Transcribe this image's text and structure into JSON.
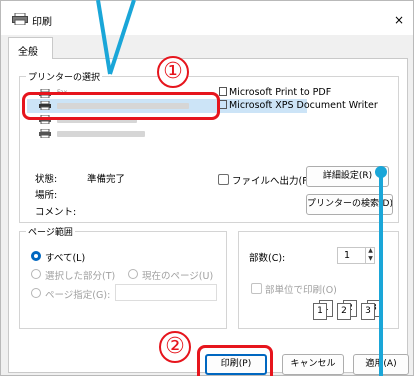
{
  "window": {
    "title": "印刷",
    "close_label": "×"
  },
  "tabs": [
    {
      "label": "全般"
    }
  ],
  "printer_group": {
    "label": "プリンターの選択"
  },
  "printers": [
    {
      "label": "Fax"
    },
    {
      "label": "Microsoft Print to PDF"
    },
    {
      "label": "Microsoft XPS Document Writer"
    }
  ],
  "status": {
    "state_label": "状態:",
    "state_value": "準備完了",
    "location_label": "場所:",
    "comment_label": "コメント:"
  },
  "print_to_file": {
    "label": "ファイルへ出力(F)"
  },
  "buttons": {
    "preferences": "詳細設定(R)",
    "find_printer": "プリンターの検索(D)...",
    "print": "印刷(P)",
    "cancel": "キャンセル",
    "apply": "適用(A)"
  },
  "page_range": {
    "label": "ページ範囲",
    "all": "すべて(L)",
    "selection": "選択した部分(T)",
    "current_page": "現在のページ(U)",
    "pages": "ページ指定(G):",
    "pages_value": ""
  },
  "copies": {
    "label": "部数(C):",
    "value": "1",
    "collate_label": "部単位で印刷(O)",
    "collate_pages": [
      "1",
      "1",
      "2",
      "2",
      "3",
      "3"
    ]
  },
  "annotations": {
    "step1": "①",
    "step2": "②"
  },
  "colors": {
    "accent": "#0067c0",
    "annotation_red": "#e6151d",
    "annotation_blue": "#1aa6d8"
  }
}
